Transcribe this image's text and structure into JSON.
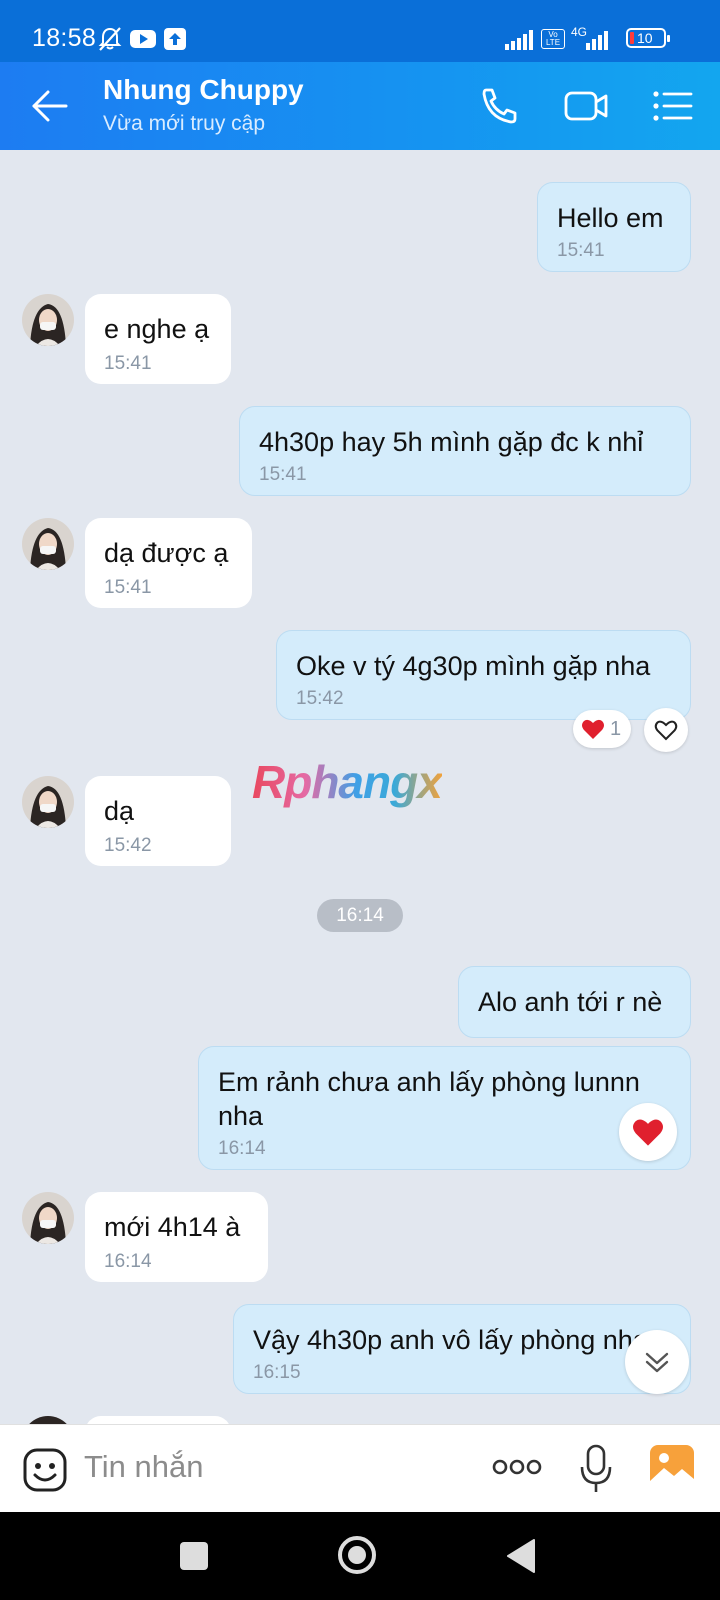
{
  "status_bar": {
    "time": "18:58",
    "network": "4G",
    "volte": "Vo LTE",
    "battery": "10"
  },
  "header": {
    "contact_name": "Nhung Chuppy",
    "status": "Vừa mới truy cập"
  },
  "messages": [
    {
      "dir": "out",
      "text": "Hello em",
      "time": "15:41"
    },
    {
      "dir": "in",
      "text": "e nghe ạ",
      "time": "15:41"
    },
    {
      "dir": "out",
      "text": "4h30p hay 5h mình gặp đc k nhỉ",
      "time": "15:41"
    },
    {
      "dir": "in",
      "text": "dạ được ạ",
      "time": "15:41"
    },
    {
      "dir": "out",
      "text": "Oke v tý 4g30p mình gặp nha",
      "time": "15:42",
      "reaction_count": "1"
    },
    {
      "dir": "in",
      "text": "dạ",
      "time": "15:42"
    },
    {
      "dir": "out",
      "text": "Alo anh tới r nè",
      "time": ""
    },
    {
      "dir": "out",
      "text": "Em rảnh chưa anh lấy phòng lunnn nha",
      "time": "16:14"
    },
    {
      "dir": "in",
      "text": "mới 4h14 à",
      "time": "16:14"
    },
    {
      "dir": "out",
      "text": "Vậy 4h30p anh vô lấy phòng nha",
      "time": "16:15"
    }
  ],
  "time_divider": "16:14",
  "watermark": "Rphangx",
  "composer": {
    "placeholder": "Tin nhắn"
  },
  "colors": {
    "header": "#1d7cf2",
    "outgoing_bubble": "#d4ecfb",
    "incoming_bubble": "#ffffff",
    "chat_background": "#e2e7ef",
    "heart": "#e0202e"
  }
}
